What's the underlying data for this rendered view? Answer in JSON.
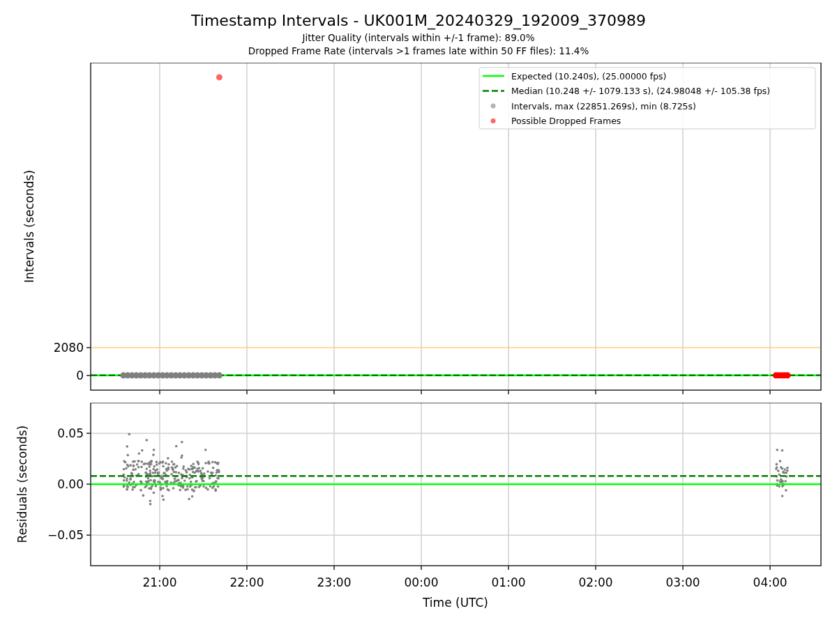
{
  "title": "Timestamp Intervals - UK001M_20240329_192009_370989",
  "subtitles": [
    "Jitter Quality (intervals within +/-1 frame): 89.0%",
    "Dropped Frame Rate (intervals >1 frames late within 50 FF files): 11.4%"
  ],
  "top_panel": {
    "chart_data": {
      "type": "scatter",
      "ylabel": "Intervals (seconds)",
      "xlim": [
        "2024-03-29T20:12:30",
        "2024-03-30T04:35"
      ],
      "ylim": [
        -1092,
        23348
      ],
      "yticks": [
        {
          "value": 0,
          "label": "0"
        },
        {
          "value": 2080,
          "label": "2080"
        }
      ],
      "grid": true,
      "legend": true,
      "ref_lines": [
        {
          "axis": "y",
          "value": 10.24,
          "color": "#00ff00",
          "label": "Expected (10.240s), (25.00000 fps)"
        },
        {
          "axis": "y",
          "value": 10.248,
          "color": "#008000",
          "label": "Median (10.248 +/- 1079.133 s), (24.98048 +/- 105.38 fps)"
        },
        {
          "axis": "y",
          "value": 2080,
          "color": "#ffd36e"
        }
      ],
      "series": [
        {
          "name": "Intervals, max (22851.269s), min (8.725s)",
          "color": "#808080",
          "x": [
            "2024-03-29T20:35",
            "2024-03-29T20:38",
            "2024-03-29T20:41",
            "2024-03-29T20:44",
            "2024-03-29T20:47",
            "2024-03-29T20:50",
            "2024-03-29T20:53",
            "2024-03-29T20:56",
            "2024-03-29T20:59",
            "2024-03-29T21:02",
            "2024-03-29T21:05",
            "2024-03-29T21:08",
            "2024-03-29T21:11",
            "2024-03-29T21:14",
            "2024-03-29T21:17",
            "2024-03-29T21:20",
            "2024-03-29T21:23",
            "2024-03-29T21:26",
            "2024-03-29T21:29",
            "2024-03-29T21:32",
            "2024-03-29T21:35",
            "2024-03-29T21:38",
            "2024-03-29T21:41"
          ],
          "values": [
            10,
            10,
            10,
            10,
            10,
            10,
            10,
            10,
            10,
            10,
            10,
            10,
            10,
            10,
            10,
            10,
            10,
            10,
            10,
            10,
            10,
            10,
            10
          ]
        },
        {
          "name": "Possible Dropped Frames",
          "color": "#ff0000",
          "x": [
            "2024-03-29T21:41",
            "2024-03-30T04:04",
            "2024-03-30T04:06",
            "2024-03-30T04:08",
            "2024-03-30T04:10",
            "2024-03-30T04:12"
          ],
          "values": [
            22260,
            10,
            10,
            10,
            10,
            10
          ]
        }
      ]
    }
  },
  "bottom_panel": {
    "chart_data": {
      "type": "scatter",
      "xlabel": "Time (UTC)",
      "ylabel": "Residuals (seconds)",
      "xlim": [
        "2024-03-29T20:12:30",
        "2024-03-30T04:35"
      ],
      "ylim": [
        -0.08,
        0.08
      ],
      "xticks": [
        {
          "value": "2024-03-29T21:00",
          "label": "21:00"
        },
        {
          "value": "2024-03-29T22:00",
          "label": "22:00"
        },
        {
          "value": "2024-03-29T23:00",
          "label": "23:00"
        },
        {
          "value": "2024-03-30T00:00",
          "label": "00:00"
        },
        {
          "value": "2024-03-30T01:00",
          "label": "01:00"
        },
        {
          "value": "2024-03-30T02:00",
          "label": "02:00"
        },
        {
          "value": "2024-03-30T03:00",
          "label": "03:00"
        },
        {
          "value": "2024-03-30T04:00",
          "label": "04:00"
        }
      ],
      "yticks": [
        {
          "value": 0.05,
          "label": "0.05"
        },
        {
          "value": 0,
          "label": "0.00"
        },
        {
          "value": -0.05,
          "label": "−0.05"
        }
      ],
      "grid": true,
      "ref_lines": [
        {
          "axis": "y",
          "value": 0,
          "color": "#00ff00"
        },
        {
          "axis": "y",
          "value": 0.008,
          "color": "#008000"
        }
      ]
    }
  }
}
